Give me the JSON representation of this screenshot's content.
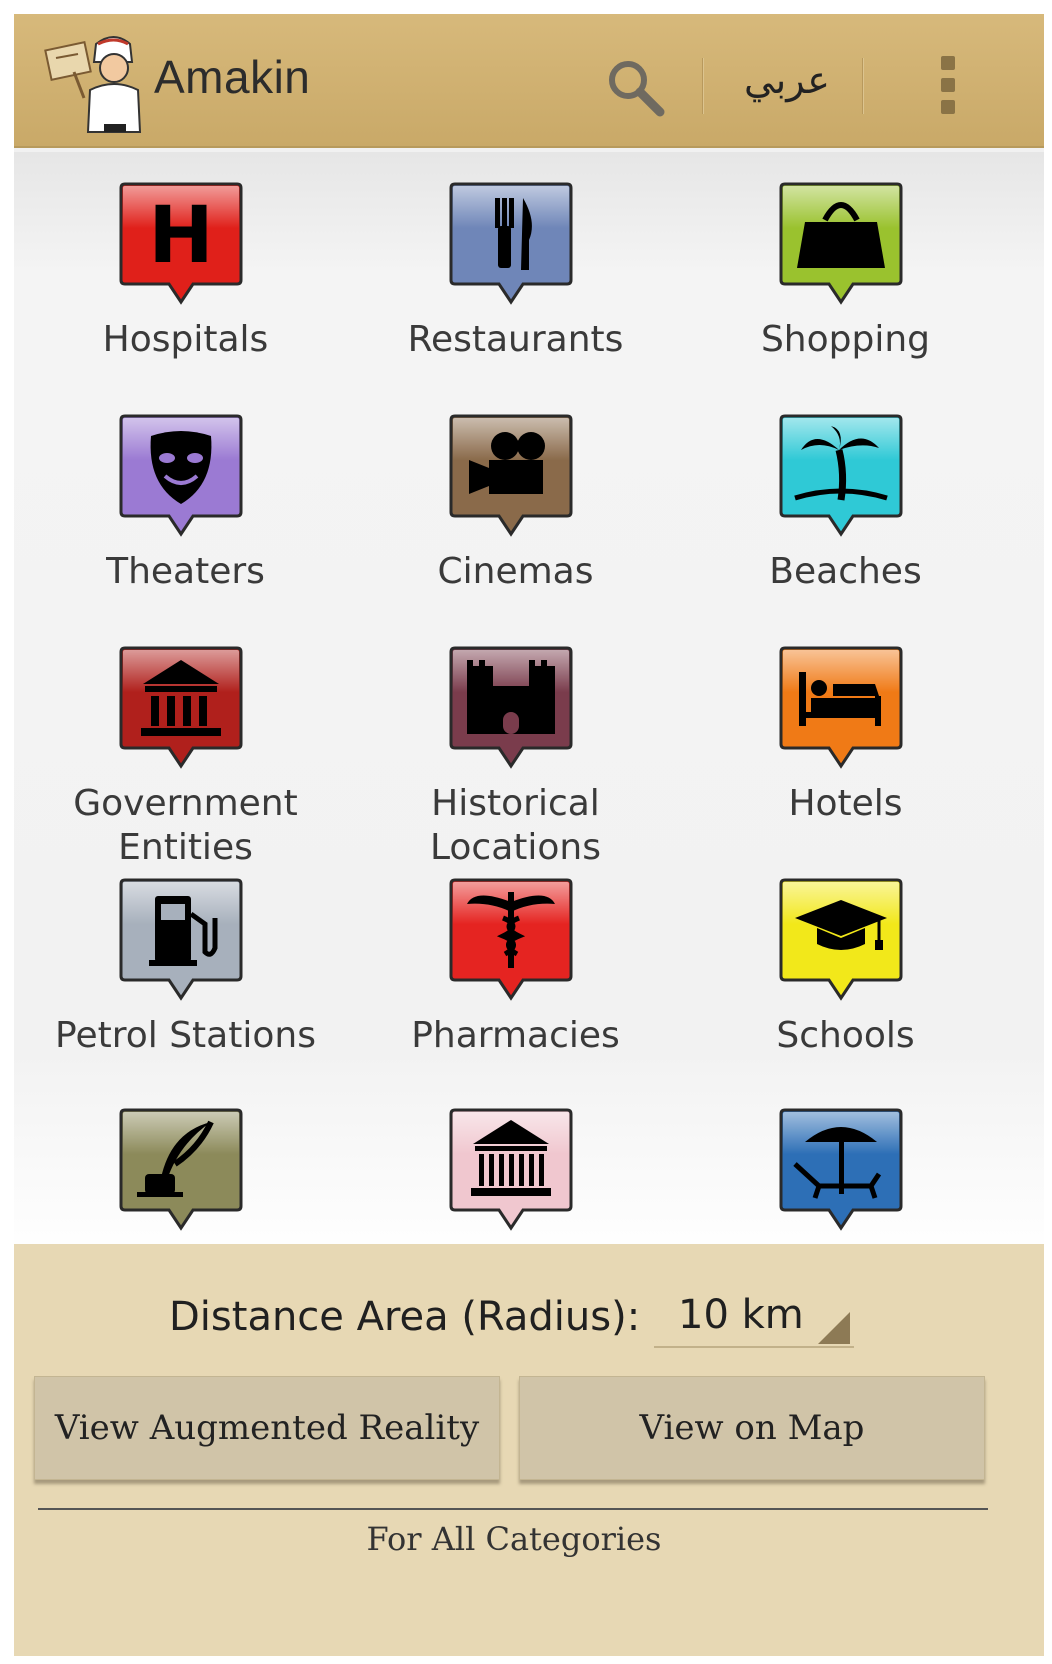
{
  "app": {
    "title": "Amakin",
    "language_toggle": "عربي"
  },
  "icons": {
    "search": "search-icon",
    "overflow": "overflow-menu-icon",
    "logo": "amakin-logo"
  },
  "categories": [
    {
      "label": "Hospitals",
      "icon": "hospital-icon",
      "color": "#e0201a"
    },
    {
      "label": "Restaurants",
      "icon": "fork-knife-icon",
      "color": "#6f86b8"
    },
    {
      "label": "Shopping",
      "icon": "shopping-bag-icon",
      "color": "#9ac22e"
    },
    {
      "label": "Theaters",
      "icon": "theater-mask-icon",
      "color": "#9b7ad3"
    },
    {
      "label": "Cinemas",
      "icon": "movie-camera-icon",
      "color": "#8a6a4a"
    },
    {
      "label": "Beaches",
      "icon": "palm-tree-icon",
      "color": "#2fc9d6"
    },
    {
      "label": "Government Entities",
      "icon": "government-building-icon",
      "color": "#b0201c"
    },
    {
      "label": "Historical Locations",
      "icon": "castle-icon",
      "color": "#7a3c4c"
    },
    {
      "label": "Hotels",
      "icon": "bed-icon",
      "color": "#f07a16"
    },
    {
      "label": "Petrol Stations",
      "icon": "fuel-pump-icon",
      "color": "#a7b0bc"
    },
    {
      "label": "Pharmacies",
      "icon": "caduceus-icon",
      "color": "#e52421"
    },
    {
      "label": "Schools",
      "icon": "graduation-cap-icon",
      "color": "#f2e81a"
    },
    {
      "label": "",
      "icon": "quill-inkwell-icon",
      "color": "#8c8a5a"
    },
    {
      "label": "",
      "icon": "museum-icon",
      "color": "#f0c7cf"
    },
    {
      "label": "",
      "icon": "beach-umbrella-chair-icon",
      "color": "#2d6fb6"
    }
  ],
  "distance": {
    "label": "Distance Area (Radius):",
    "value": "10 km"
  },
  "buttons": {
    "augmented_reality": "View Augmented Reality",
    "map": "View on Map"
  },
  "footer": {
    "text": "For All Categories"
  }
}
